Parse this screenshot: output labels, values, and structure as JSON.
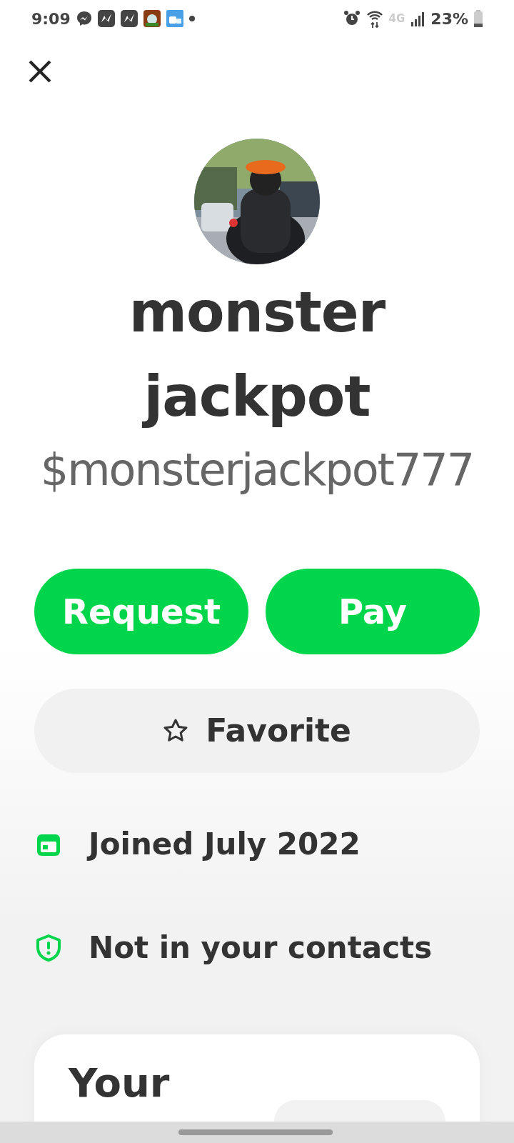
{
  "status_bar": {
    "time": "9:09",
    "network": "4G",
    "battery": "23%"
  },
  "profile": {
    "display_name": "monster jackpot",
    "cashtag": "$monsterjackpot777"
  },
  "actions": [
    {
      "label": "Request"
    },
    {
      "label": "Pay"
    }
  ],
  "favorite": {
    "label": "Favorite",
    "on": false
  },
  "info": [
    {
      "kind": "calendar",
      "text": "Joined July 2022"
    },
    {
      "kind": "shield",
      "text": "Not in your contacts"
    }
  ],
  "activity_card": {
    "title": "Your"
  }
}
